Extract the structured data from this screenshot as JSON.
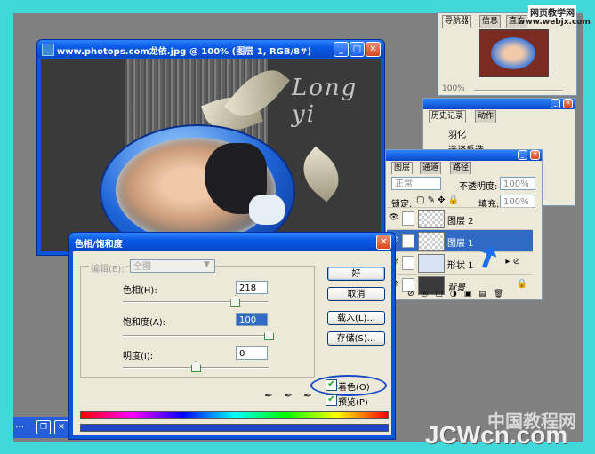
{
  "document": {
    "title": "www.photops.com龙依.jpg @ 100% (图层 1, RGB/8#)",
    "watermark_text": "Long yi"
  },
  "navigator": {
    "tabs": [
      "导航器",
      "信息",
      "直方"
    ],
    "zoom": "100%"
  },
  "history": {
    "tabs": [
      "历史记录",
      "动作"
    ],
    "items": [
      "羽化",
      "选择反选"
    ]
  },
  "layers": {
    "tabs": [
      "图层",
      "通道",
      "路径"
    ],
    "blend_mode": "正常",
    "opacity_label": "不透明度:",
    "opacity_value": "100%",
    "lock_label": "锁定:",
    "fill_label": "填充:",
    "fill_value": "100%",
    "rows": [
      {
        "name": "图层 2",
        "selected": false
      },
      {
        "name": "图层 1",
        "selected": true
      },
      {
        "name": "形状 1",
        "selected": false
      },
      {
        "name": "背景",
        "selected": false
      }
    ]
  },
  "hue_dialog": {
    "title": "色相/饱和度",
    "edit_label": "编辑(E):",
    "edit_value": "全图",
    "hue_label": "色相(H):",
    "hue_value": "218",
    "hue_level": 0.77,
    "saturation_label": "饱和度(A):",
    "saturation_value": "100",
    "saturation_level": 1.0,
    "lightness_label": "明度(I):",
    "lightness_value": "0",
    "lightness_level": 0.5,
    "buttons": {
      "ok": "好",
      "cancel": "取消",
      "load": "载入(L)...",
      "save": "存储(S)..."
    },
    "colorize_label": "着色(O)",
    "colorize_checked": true,
    "preview_label": "预览(P)",
    "preview_checked": true
  },
  "watermarks": {
    "top_right_1": "网页教学网",
    "top_right_2": "www.webjx.com",
    "bottom_cn": "中国教程网",
    "bottom_en": "JCWcn.com"
  },
  "colors": {
    "xp_blue": "#0a55d8",
    "frame_cyan": "#40d8d8",
    "workspace": "#808080"
  }
}
